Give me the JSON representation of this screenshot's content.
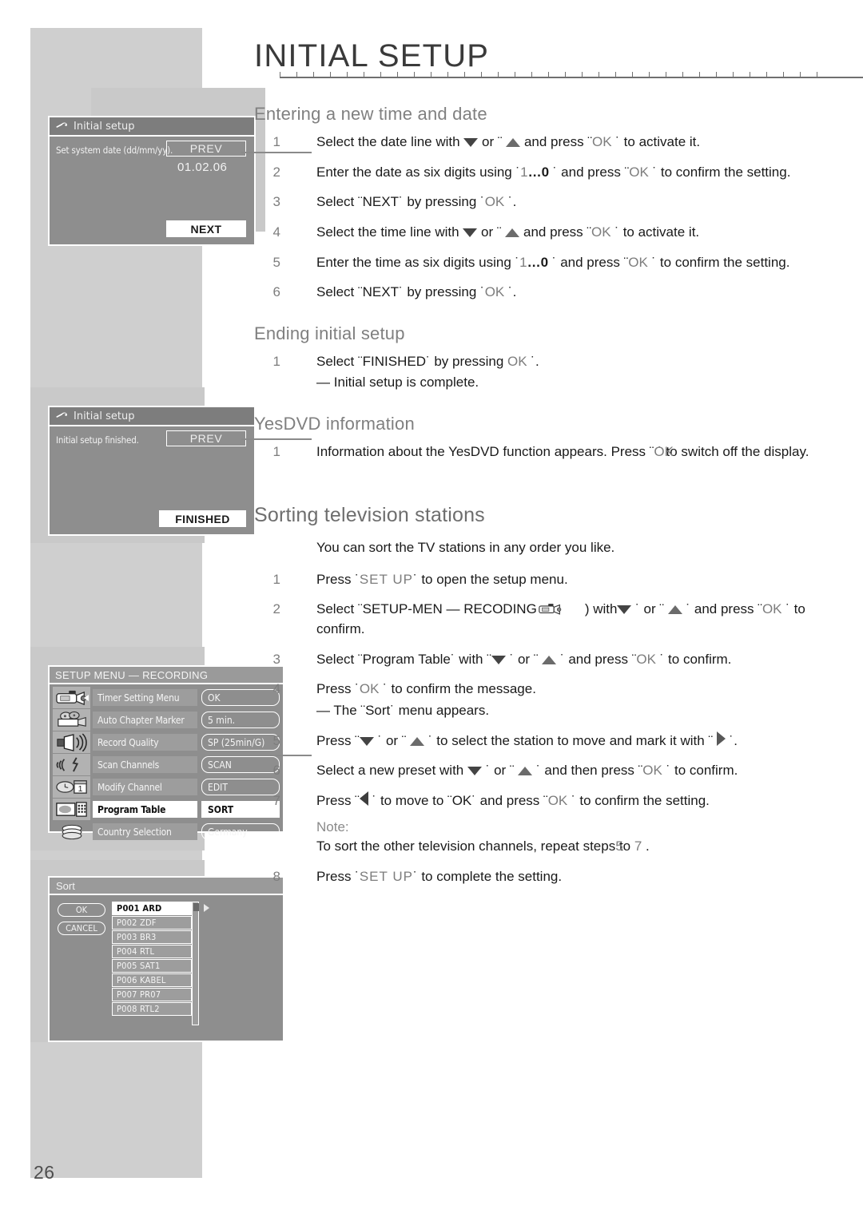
{
  "header": {
    "title": "INITIAL SETUP"
  },
  "page_number": "26",
  "screens": {
    "date_screen": {
      "title": "Initial setup",
      "title_icon": "wrench-icon",
      "message": "Set system date (dd/mm/yy).",
      "prev_label": "PREV",
      "date_value": "01.02.06",
      "next_label": "NEXT"
    },
    "finished_screen": {
      "title": "Initial setup",
      "title_icon": "wrench-icon",
      "message": "Initial setup finished.",
      "prev_label": "PREV",
      "finished_label": "FINISHED"
    },
    "setup_menu": {
      "title": "SETUP MENU — RECORDING",
      "rows": [
        {
          "label": "Timer Setting Menu",
          "value": "OK",
          "icon": "camcorder-icon",
          "selected": false,
          "caret": true
        },
        {
          "label": "Auto Chapter Marker",
          "value": "5 min.",
          "icon": "film-camera-icon",
          "selected": false,
          "caret": false
        },
        {
          "label": "Record Quality",
          "value": "SP (25min/G)",
          "icon": "megaphone-icon",
          "selected": false,
          "caret": false
        },
        {
          "label": "Scan Channels",
          "value": "SCAN",
          "icon": "antenna-icon",
          "selected": false,
          "caret": false
        },
        {
          "label": "Modify Channel",
          "value": "EDIT",
          "icon": "clock-calendar-icon",
          "selected": false,
          "caret": false
        },
        {
          "label": "Program Table",
          "value": "SORT",
          "icon": "remote-tv-icon",
          "selected": true,
          "caret": false
        },
        {
          "label": "Country Selection",
          "value": "Germany",
          "icon": "discs-icon",
          "selected": false,
          "caret": false
        }
      ]
    },
    "sort_dialog": {
      "title": "Sort",
      "ok_label": "OK",
      "cancel_label": "CANCEL",
      "channels": [
        {
          "preset": "P001",
          "name": "ARD",
          "selected": true
        },
        {
          "preset": "P002",
          "name": "ZDF",
          "selected": false
        },
        {
          "preset": "P003",
          "name": "BR3",
          "selected": false
        },
        {
          "preset": "P004",
          "name": "RTL",
          "selected": false
        },
        {
          "preset": "P005",
          "name": "SAT1",
          "selected": false
        },
        {
          "preset": "P006",
          "name": "KABEL",
          "selected": false
        },
        {
          "preset": "P007",
          "name": "PR07",
          "selected": false
        },
        {
          "preset": "P008",
          "name": "RTL2",
          "selected": false
        }
      ]
    }
  },
  "sections": {
    "entering_time_date": {
      "heading": "Entering a new time and date",
      "steps": [
        {
          "num": "1",
          "pre": "Select the date line with ",
          "mid": " or ¨ ",
          "post": " and press ¨",
          "key": "OK",
          "tail": " ˙ to activate it.",
          "icons": [
            "tri-down",
            "tri-up"
          ]
        },
        {
          "num": "2",
          "text_a": "Enter the date as six digits using ˙",
          "text_b": "1",
          "text_c": "…0",
          "text_d": " ˙ and press ¨",
          "key": "OK",
          "tail": " ˙ to confirm the setting."
        },
        {
          "num": "3",
          "text": "Select ¨NEXT˙ by pressing ˙",
          "key": "OK",
          "tail": " ˙."
        },
        {
          "num": "4",
          "pre": "Select the time line with ",
          "mid": " or ¨ ",
          "post": " and press ¨",
          "key": "OK",
          "tail": " ˙ to activate it.",
          "icons": [
            "tri-down",
            "tri-up"
          ]
        },
        {
          "num": "5",
          "text_a": "Enter the time as six digits using ˙",
          "text_b": "1",
          "text_c": "…0",
          "text_d": " ˙ and press ¨",
          "key": "OK",
          "tail": " ˙ to confirm the setting."
        },
        {
          "num": "6",
          "text": "Select ¨NEXT˙ by pressing ˙",
          "key": "OK",
          "tail": " ˙."
        }
      ]
    },
    "ending_setup": {
      "heading": "Ending initial setup",
      "steps": [
        {
          "num": "1",
          "text": "Select ¨FINISHED˙ by pressing ",
          "key": "OK",
          "tail": " ˙.",
          "sub": "— Initial setup is complete."
        }
      ]
    },
    "yesdvd": {
      "heading": "YesDVD information",
      "steps": [
        {
          "num": "1",
          "text": "Information about the YesDVD function appears. Press ¨",
          "key": "OK",
          "tail": " ˙ to switch off the display."
        }
      ]
    },
    "sorting": {
      "heading": "Sorting television stations",
      "lead": "You can sort the TV stations in any order you like.",
      "steps": [
        {
          "num": "1",
          "pre": "Press ˙",
          "key": "SET UP",
          "tail": "˙ to open the setup menu."
        },
        {
          "num": "2",
          "pre": "Select  ¨SETUP-MEN  —  RECODING",
          "icon": "camcorder-icon",
          "mid": ")  with",
          "post": " ˙ or ¨ ",
          "post2": " ˙ and press ¨",
          "key": "OK",
          "tail": " ˙ to confirm.",
          "icons": [
            "tri-down",
            "tri-up"
          ]
        },
        {
          "num": "3",
          "pre": "Select ¨Program Table˙ with ¨",
          "mid": " ˙ or ¨ ",
          "post": " ˙ and press ¨",
          "key": "OK",
          "tail": " ˙ to confirm.",
          "icons": [
            "tri-down",
            "tri-up"
          ]
        },
        {
          "num": "4",
          "pre": "Press ˙",
          "key": "OK",
          "tail": " ˙ to confirm the message.",
          "sub": "— The ¨Sort˙ menu appears."
        },
        {
          "num": "5",
          "pre": "Press ¨",
          "mid": " ˙ or ¨ ",
          "post": " ˙ to select the station to move and mark it with ¨ ",
          "tail": " ˙.",
          "icons": [
            "tri-down",
            "tri-up",
            "tri-right"
          ]
        },
        {
          "num": "6",
          "pre": "Select a new preset with ",
          "mid": " ˙ or ¨ ",
          "post": " ˙ and then press ¨",
          "key": "OK",
          "tail": " ˙ to confirm.",
          "icons": [
            "tri-down",
            "tri-up"
          ]
        },
        {
          "num": "7",
          "pre": "Press ¨",
          "mid": " ˙ to move to ¨OK˙ and press ¨",
          "key": "OK",
          "tail": " ˙ to confirm the setting.",
          "icons": [
            "tri-left"
          ],
          "note_label": "Note:",
          "note_a": "To sort the other television channels, repeat steps",
          "note_b": "5",
          "note_c": " to ",
          "note_d": "7",
          "note_e": " ."
        },
        {
          "num": "8",
          "pre": "Press ˙",
          "key": "SET UP",
          "tail": "˙ to complete the setting."
        }
      ]
    }
  }
}
